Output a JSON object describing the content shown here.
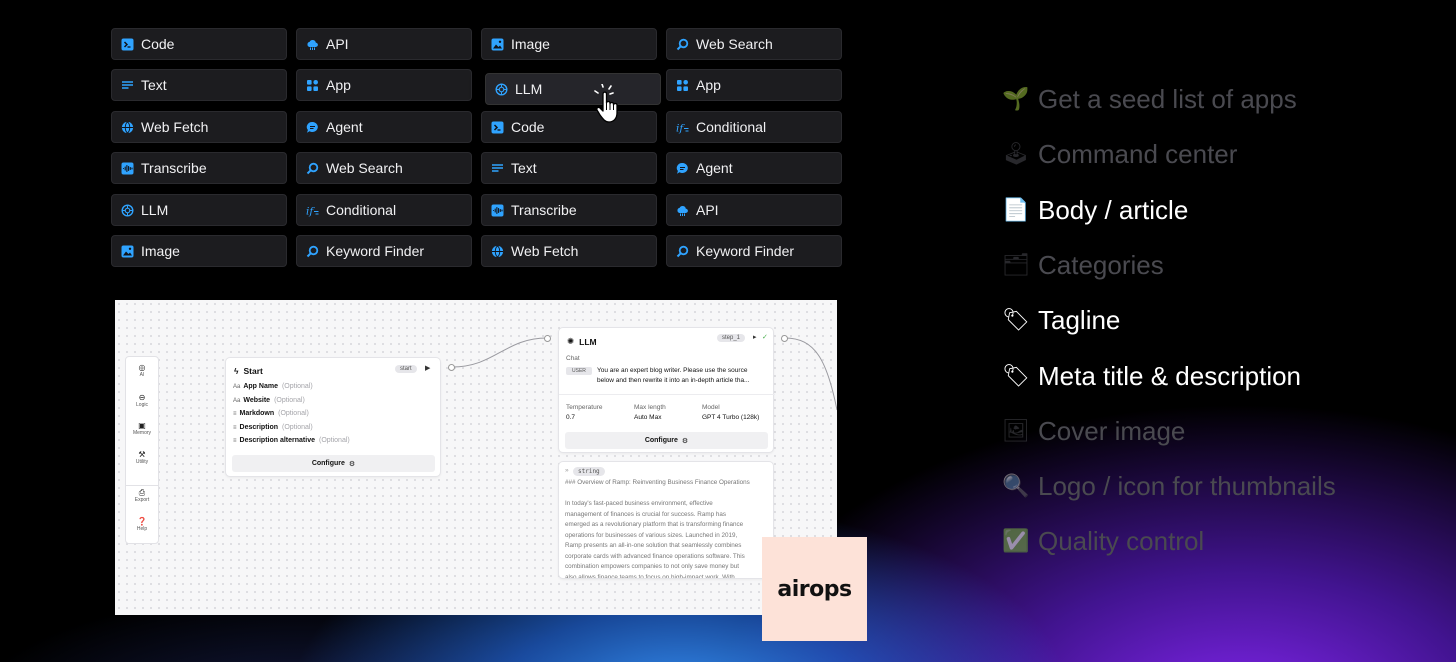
{
  "blocks": [
    {
      "label": "Code",
      "icon": "terminal-icon"
    },
    {
      "label": "API",
      "icon": "cloud-icon"
    },
    {
      "label": "Image",
      "icon": "image-icon"
    },
    {
      "label": "Web Search",
      "icon": "search-icon"
    },
    {
      "label": "Text",
      "icon": "text-lines-icon"
    },
    {
      "label": "App",
      "icon": "apps-grid-icon"
    },
    {
      "label": "LLM",
      "icon": "llm-icon"
    },
    {
      "label": "App",
      "icon": "apps-grid-icon"
    },
    {
      "label": "Web Fetch",
      "icon": "globe-icon"
    },
    {
      "label": "Agent",
      "icon": "chat-bubble-icon"
    },
    {
      "label": "Code",
      "icon": "terminal-icon"
    },
    {
      "label": "Conditional",
      "icon": "conditional-icon"
    },
    {
      "label": "Transcribe",
      "icon": "waveform-icon"
    },
    {
      "label": "Web Search",
      "icon": "search-icon"
    },
    {
      "label": "Text",
      "icon": "text-lines-icon"
    },
    {
      "label": "Agent",
      "icon": "chat-bubble-icon"
    },
    {
      "label": "LLM",
      "icon": "llm-icon"
    },
    {
      "label": "Conditional",
      "icon": "conditional-icon"
    },
    {
      "label": "Transcribe",
      "icon": "waveform-icon"
    },
    {
      "label": "API",
      "icon": "cloud-icon"
    },
    {
      "label": "Image",
      "icon": "image-icon"
    },
    {
      "label": "Keyword Finder",
      "icon": "search-icon"
    },
    {
      "label": "Web Fetch",
      "icon": "globe-icon"
    },
    {
      "label": "Keyword Finder",
      "icon": "search-icon"
    }
  ],
  "colors": {
    "block_icon": "#2fa3ff",
    "block_bg": "#1c1c1f",
    "logo_bg": "#fde2d8",
    "dim_text": "#4a4a50"
  },
  "canvas": {
    "sidebar": [
      {
        "label": "AI",
        "icon": "ai-icon"
      },
      {
        "label": "Logic",
        "icon": "logic-icon"
      },
      {
        "label": "Memory",
        "icon": "memory-icon"
      },
      {
        "label": "Utility",
        "icon": "utility-icon"
      },
      {
        "label": "Export",
        "icon": "export-icon"
      },
      {
        "label": "Help",
        "icon": "help-icon"
      }
    ],
    "start_node": {
      "title": "Start",
      "badge": "start",
      "fields": [
        {
          "name": "App Name",
          "type": "Aa",
          "optional": "(Optional)"
        },
        {
          "name": "Website",
          "type": "Aa",
          "optional": "(Optional)"
        },
        {
          "name": "Markdown",
          "type": "≡",
          "optional": "(Optional)"
        },
        {
          "name": "Description",
          "type": "≡",
          "optional": "(Optional)"
        },
        {
          "name": "Description alternative",
          "type": "≡",
          "optional": "(Optional)"
        }
      ],
      "configure": "Configure"
    },
    "llm_node": {
      "title": "LLM",
      "badge": "step_1",
      "chat_label": "Chat",
      "role": "USER",
      "prompt_line1": "You are an expert blog writer. Please use the source",
      "prompt_line2": "below and then rewrite it into an in-depth article tha...",
      "params": [
        {
          "label": "Temperature",
          "value": "0.7"
        },
        {
          "label": "Max length",
          "value": "Auto Max"
        },
        {
          "label": "Model",
          "value": "GPT 4 Turbo (128k)"
        }
      ],
      "configure": "Configure"
    },
    "output_node": {
      "type_badge": "string",
      "lines": [
        "### Overview of Ramp: Reinventing Business Finance Operations",
        "",
        "In today's fast-paced business environment, effective",
        "management of finances is crucial for success. Ramp has",
        "emerged as a revolutionary platform that is transforming finance",
        "operations for businesses of various sizes. Launched in 2019,",
        "Ramp presents an all-in-one solution that seamlessly combines",
        "corporate cards with advanced finance operations software. This",
        "combination empowers companies to not only save money but",
        "also allows finance teams to focus on high-impact work. With"
      ]
    }
  },
  "logo": {
    "text": "airops"
  },
  "checklist": [
    {
      "emoji": "🌱",
      "label": "Get a seed list of apps",
      "active": false
    },
    {
      "emoji": "🕹",
      "label": "Command center",
      "active": false
    },
    {
      "emoji": "📄",
      "label": "Body / article",
      "active": true
    },
    {
      "emoji": "🗂",
      "label": "Categories",
      "active": false
    },
    {
      "emoji": "🏷",
      "label": "Tagline",
      "active": true
    },
    {
      "emoji": "🏷",
      "label": "Meta title & description",
      "active": true
    },
    {
      "emoji": "🖼",
      "label": "Cover image",
      "active": false
    },
    {
      "emoji": "🔍",
      "label": "Logo / icon for thumbnails",
      "active": false
    },
    {
      "emoji": "✅",
      "label": "Quality control",
      "active": false
    }
  ]
}
